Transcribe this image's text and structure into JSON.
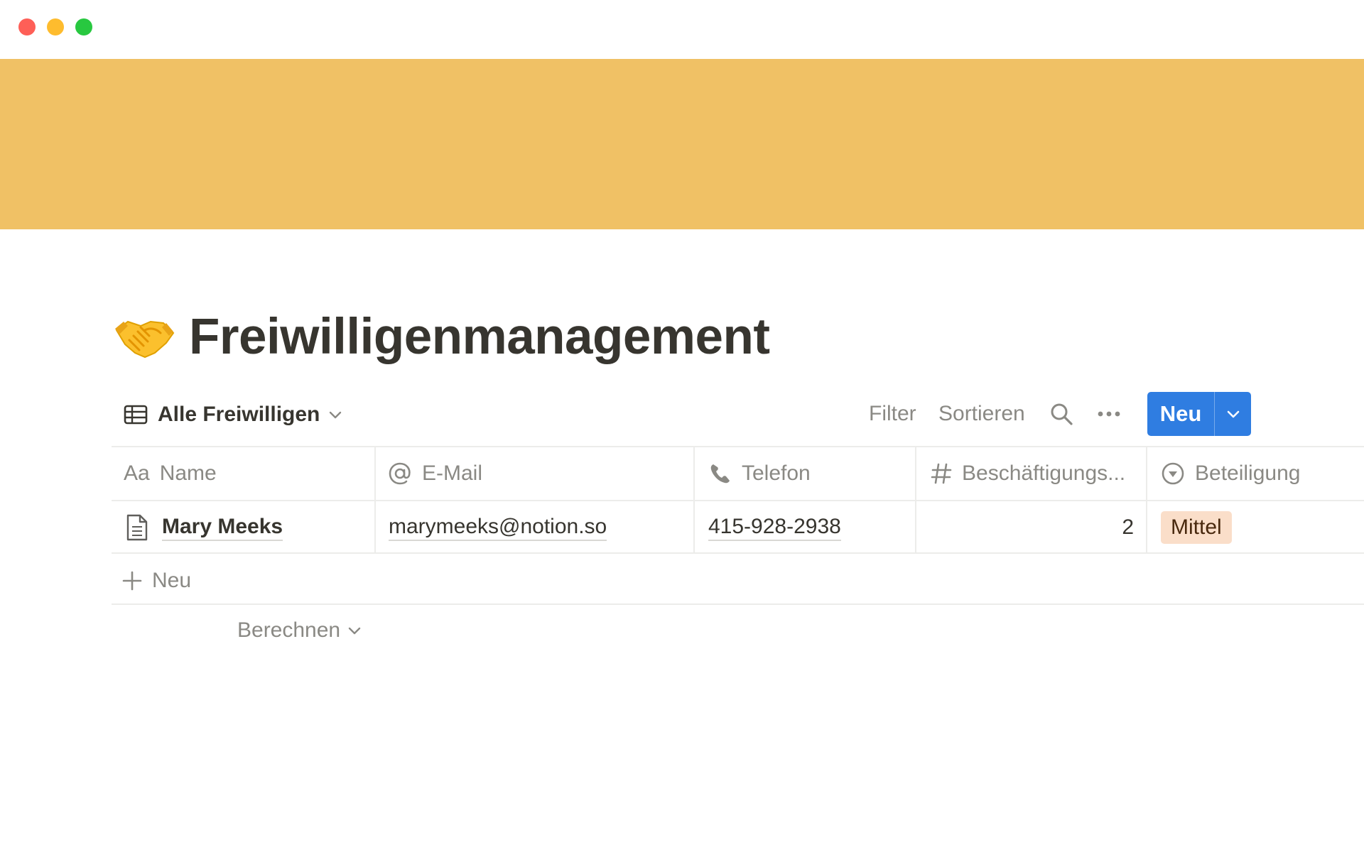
{
  "window": {
    "controls": [
      "close",
      "minimize",
      "zoom"
    ]
  },
  "cover": {
    "color": "#f0c165"
  },
  "page": {
    "emoji_icon": "handshake-emoji",
    "title": "Freiwilligenmanagement"
  },
  "view": {
    "icon": "table-icon",
    "label": "Alle Freiwilligen"
  },
  "toolbar": {
    "filter_label": "Filter",
    "sort_label": "Sortieren",
    "search_icon": "search-icon",
    "more_icon": "more-icon",
    "new_label": "Neu",
    "accent": "#2f7de1"
  },
  "table": {
    "columns": [
      {
        "icon_text": "Aa",
        "label": "Name"
      },
      {
        "icon": "at-icon",
        "label": "E-Mail"
      },
      {
        "icon": "phone-icon",
        "label": "Telefon"
      },
      {
        "icon": "number-icon",
        "label": "Beschäftigungs..."
      },
      {
        "icon": "select-icon",
        "label": "Beteiligung"
      }
    ],
    "rows": [
      {
        "name": "Mary Meeks",
        "email": "marymeeks@notion.so",
        "phone": "415-928-2938",
        "count": "2",
        "engagement": "Mittel",
        "engagement_color": "#fadec9"
      }
    ],
    "add_row_label": "Neu",
    "calculate_label": "Berechnen"
  }
}
